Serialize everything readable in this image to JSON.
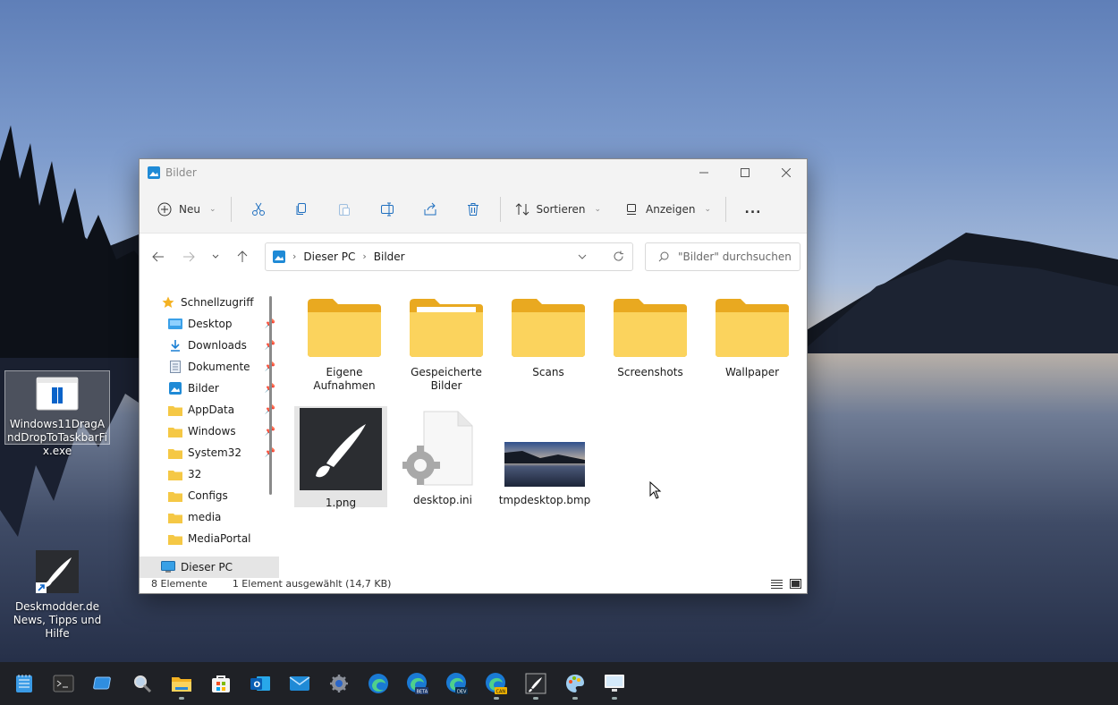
{
  "desktop": {
    "icons": [
      {
        "label": "Windows11DragAndDropToTaskbarFix.exe"
      },
      {
        "label": "Deskmodder.de News, Tipps und Hilfe"
      }
    ]
  },
  "window": {
    "title": "Bilder",
    "controls": {
      "minimize": "minimize",
      "maximize": "maximize",
      "close": "close"
    }
  },
  "toolbar": {
    "new_label": "Neu",
    "sort_label": "Sortieren",
    "view_label": "Anzeigen",
    "more_label": "..."
  },
  "address": {
    "crumbs": [
      "Dieser PC",
      "Bilder"
    ]
  },
  "search": {
    "placeholder": "\"Bilder\" durchsuchen"
  },
  "sidebar": {
    "items": [
      {
        "label": "Schnellzugriff",
        "icon": "star-icon"
      },
      {
        "label": "Desktop",
        "icon": "desktop-folder-icon",
        "pinned": true
      },
      {
        "label": "Downloads",
        "icon": "download-icon",
        "pinned": true
      },
      {
        "label": "Dokumente",
        "icon": "documents-icon",
        "pinned": true
      },
      {
        "label": "Bilder",
        "icon": "pictures-icon",
        "pinned": true
      },
      {
        "label": "AppData",
        "icon": "folder-icon",
        "pinned": true
      },
      {
        "label": "Windows",
        "icon": "folder-icon",
        "pinned": true
      },
      {
        "label": "System32",
        "icon": "folder-icon",
        "pinned": true
      },
      {
        "label": "32",
        "icon": "folder-icon"
      },
      {
        "label": "Configs",
        "icon": "folder-icon"
      },
      {
        "label": "media",
        "icon": "folder-icon"
      },
      {
        "label": "MediaPortal",
        "icon": "folder-icon"
      },
      {
        "label": "Dieser PC",
        "icon": "computer-icon"
      }
    ]
  },
  "files": [
    {
      "name": "Eigene Aufnahmen",
      "type": "folder"
    },
    {
      "name": "Gespeicherte Bilder",
      "type": "folder"
    },
    {
      "name": "Scans",
      "type": "folder"
    },
    {
      "name": "Screenshots",
      "type": "folder"
    },
    {
      "name": "Wallpaper",
      "type": "folder"
    },
    {
      "name": "1.png",
      "type": "image",
      "selected": true
    },
    {
      "name": "desktop.ini",
      "type": "settings-file"
    },
    {
      "name": "tmpdesktop.bmp",
      "type": "image"
    }
  ],
  "status": {
    "count": "8 Elemente",
    "selection": "1 Element ausgewählt (14,7 KB)"
  },
  "taskbar": {
    "apps": [
      "notepad",
      "terminal",
      "remote-desktop",
      "search",
      "file-explorer",
      "store",
      "outlook",
      "mail",
      "settings",
      "edge",
      "edge-beta",
      "edge-dev",
      "edge-canary",
      "paint",
      "paint-3d",
      "remote-display"
    ]
  },
  "colors": {
    "folder": "#f5c845",
    "accent": "#0078d4"
  }
}
